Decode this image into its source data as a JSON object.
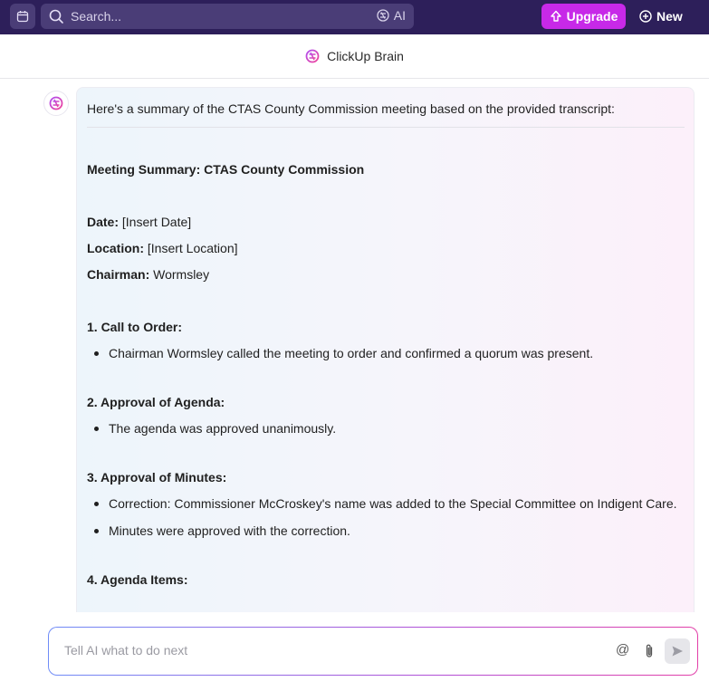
{
  "topbar": {
    "search_placeholder": "Search...",
    "ai_label": "AI",
    "upgrade_label": "Upgrade",
    "new_label": "New"
  },
  "header": {
    "title": "ClickUp Brain"
  },
  "message": {
    "intro": "Here's a summary of the CTAS County Commission meeting based on the provided transcript:",
    "heading": "Meeting Summary: CTAS County Commission",
    "date_label": "Date:",
    "date_value": "[Insert Date]",
    "location_label": "Location:",
    "location_value": "[Insert Location]",
    "chairman_label": "Chairman:",
    "chairman_value": "Wormsley",
    "sections": [
      {
        "title": "1. Call to Order:",
        "bullets": [
          "Chairman Wormsley called the meeting to order and confirmed a quorum was present."
        ]
      },
      {
        "title": "2. Approval of Agenda:",
        "bullets": [
          "The agenda was approved unanimously."
        ]
      },
      {
        "title": "3. Approval of Minutes:",
        "bullets": [
          "Correction: Commissioner McCroskey's name was added to the Special Committee on Indigent Care.",
          "Minutes were approved with the correction."
        ]
      },
      {
        "title": "4. Agenda Items:",
        "bullets": []
      }
    ]
  },
  "input": {
    "placeholder": "Tell AI what to do next",
    "mention_symbol": "@"
  },
  "colors": {
    "topbar": "#2d1f5a",
    "upgrade": "#c729e8",
    "brand_gradient": [
      "#6f8cf7",
      "#b24fd6",
      "#e23fa8"
    ]
  }
}
